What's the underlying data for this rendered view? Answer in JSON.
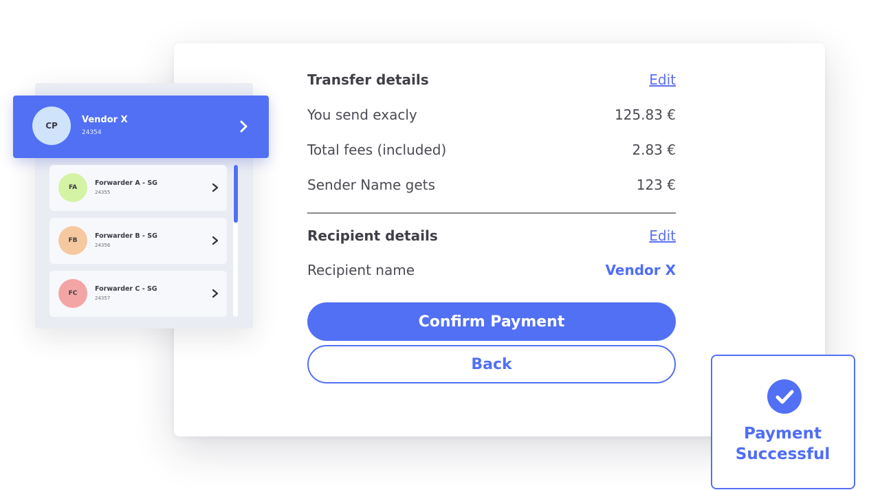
{
  "transfer": {
    "heading": "Transfer details",
    "edit_label": "Edit",
    "rows": [
      {
        "label": "You send exacly",
        "value": "125.83 €"
      },
      {
        "label": "Total fees (included)",
        "value": "2.83 €"
      },
      {
        "label": "Sender Name gets",
        "value": "123 €"
      }
    ]
  },
  "recipient": {
    "heading": "Recipient details",
    "edit_label": "Edit",
    "name_label": "Recipient name",
    "name_value": "Vendor X"
  },
  "actions": {
    "confirm_label": "Confirm Payment",
    "back_label": "Back"
  },
  "vendor": {
    "initials": "CP",
    "name": "Vendor X",
    "id": "24354"
  },
  "forwarders": [
    {
      "initials": "FA",
      "name": "Forwarder A - SG",
      "id": "24355",
      "color": "#d4f3a4"
    },
    {
      "initials": "FB",
      "name": "Forwarder B - SG",
      "id": "24356",
      "color": "#f6c8a0"
    },
    {
      "initials": "FC",
      "name": "Forwarder C - SG",
      "id": "24357",
      "color": "#f3a5a5"
    }
  ],
  "success": {
    "line1": "Payment",
    "line2": "Successful",
    "icon": "check-circle-icon"
  },
  "colors": {
    "accent": "#5270f4",
    "text": "#3f3f46"
  }
}
